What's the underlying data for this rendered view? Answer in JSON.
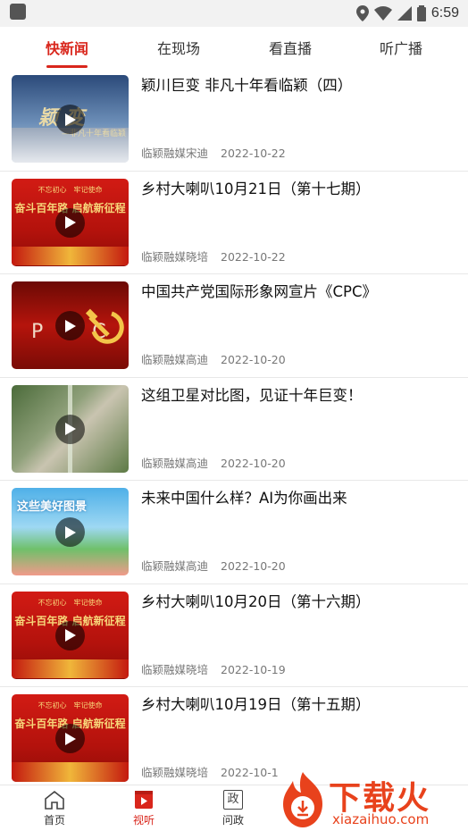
{
  "status_bar": {
    "time": "6:59"
  },
  "tabs": [
    {
      "label": "快新闻",
      "active": true
    },
    {
      "label": "在现场",
      "active": false
    },
    {
      "label": "看直播",
      "active": false
    },
    {
      "label": "听广播",
      "active": false
    }
  ],
  "news": [
    {
      "title": "颖川巨变 非凡十年看临颖（四）",
      "source": "临颖融媒宋迪",
      "date": "2022-10-22",
      "thumb": "city",
      "thumb_text": "颖 变",
      "thumb_sub": "—非凡十年看临颖"
    },
    {
      "title": "乡村大喇叭10月21日（第十七期）",
      "source": "临颖融媒晓培",
      "date": "2022-10-22",
      "thumb": "party",
      "thumb_text": "奋斗百年路 启航新征程",
      "thumb_sub": "不忘初心　牢记使命"
    },
    {
      "title": "中国共产党国际形象网宣片《CPC》",
      "source": "临颖融媒高迪",
      "date": "2022-10-20",
      "thumb": "cpc",
      "thumb_text": "P C",
      "thumb_sub": ""
    },
    {
      "title": "这组卫星对比图，见证十年巨变！",
      "source": "临颖融媒高迪",
      "date": "2022-10-20",
      "thumb": "satellite",
      "thumb_text": "",
      "thumb_sub": ""
    },
    {
      "title": "未来中国什么样？AI为你画出来",
      "source": "临颖融媒高迪",
      "date": "2022-10-20",
      "thumb": "ai",
      "thumb_text": "这些美好图景",
      "thumb_sub": ""
    },
    {
      "title": "乡村大喇叭10月20日（第十六期）",
      "source": "临颖融媒晓培",
      "date": "2022-10-19",
      "thumb": "party",
      "thumb_text": "奋斗百年路 启航新征程",
      "thumb_sub": "不忘初心　牢记使命"
    },
    {
      "title": "乡村大喇叭10月19日（第十五期）",
      "source": "临颖融媒晓培",
      "date": "2022-10-1",
      "thumb": "party",
      "thumb_text": "奋斗百年路 启航新征程",
      "thumb_sub": "不忘初心　牢记使命"
    }
  ],
  "bottom_nav": [
    {
      "label": "首页",
      "icon": "home-icon",
      "active": false
    },
    {
      "label": "视听",
      "icon": "video-icon",
      "active": true
    },
    {
      "label": "问政",
      "icon": "politics-icon",
      "active": false
    }
  ],
  "nav_icon_glyph": "政",
  "watermark": {
    "text": "下载火",
    "sub": "xiazaihuo.com"
  },
  "colors": {
    "accent": "#d9261c",
    "watermark": "#e8421c"
  }
}
